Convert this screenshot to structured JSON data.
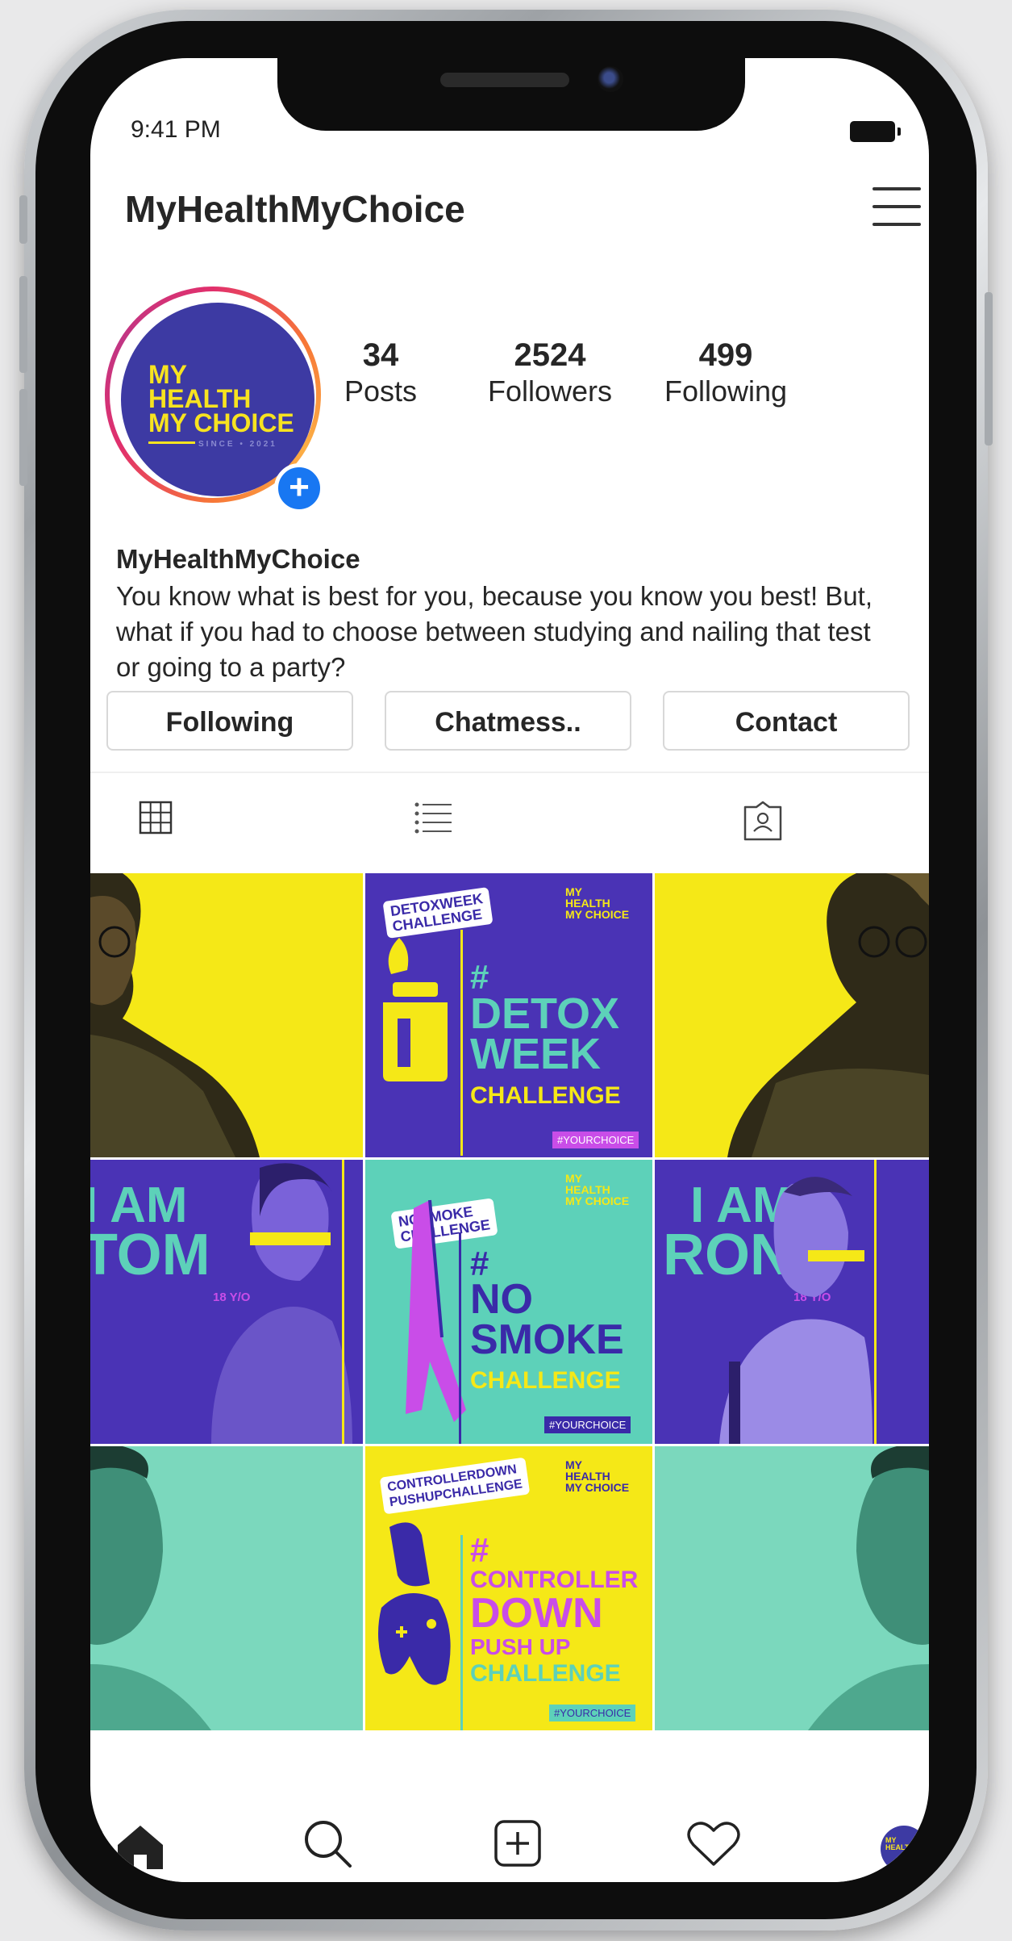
{
  "status_bar": {
    "time": "9:41 PM"
  },
  "header": {
    "title": "MyHealthMyChoice"
  },
  "profile": {
    "avatar_lines": [
      "MY",
      "HEALTH",
      "MY CHOICE",
      "SINCE • 2021"
    ],
    "stats": [
      {
        "value": "34",
        "label": "Posts"
      },
      {
        "value": "2524",
        "label": "Followers"
      },
      {
        "value": "499",
        "label": "Following"
      }
    ],
    "bio_name": "MyHealthMyChoice",
    "bio_text": "You know what is best for you, because you know you best! But, what if you had to choose between studying and nailing that test or going to a party?"
  },
  "actions": {
    "following": "Following",
    "chat": "Chatmess..",
    "contact": "Contact"
  },
  "tabs": [
    "grid-icon",
    "list-icon",
    "tagged-icon"
  ],
  "posts": {
    "brand": "MY\nHEALTH\nMY CHOICE",
    "hashtag": "#YOURCHOICE",
    "detox": {
      "tag": "DETOXWEEK\nCHALLENGE",
      "hash": "#",
      "big1": "DETOX",
      "big2": "WEEK",
      "big3": "CHALLENGE"
    },
    "tom": {
      "text1": "I AM",
      "text2": "TOM",
      "age": "18 Y/O"
    },
    "nosmoke": {
      "tag": "NOSMOKE\nCHALLENGE",
      "hash": "#",
      "big1": "NO",
      "big2": "SMOKE",
      "big3": "CHALLENGE"
    },
    "ron": {
      "text1": "I AM",
      "text2": "RON",
      "age": "18 Y/O"
    },
    "controller": {
      "tag": "CONTROLLERDOWN\nPUSHUPCHALLENGE",
      "hash": "#",
      "big1": "CONTROLLER",
      "big2": "DOWN",
      "big3": "PUSH UP",
      "big4": "CHALLENGE"
    }
  },
  "bottom_nav": [
    "home-icon",
    "search-icon",
    "add-post-icon",
    "heart-icon",
    "profile-avatar"
  ],
  "colors": {
    "yellow": "#f5e817",
    "purple": "#4a33b5",
    "teal": "#5dd1b9",
    "mint": "#7bd8bd",
    "link_blue": "#1877f2"
  }
}
